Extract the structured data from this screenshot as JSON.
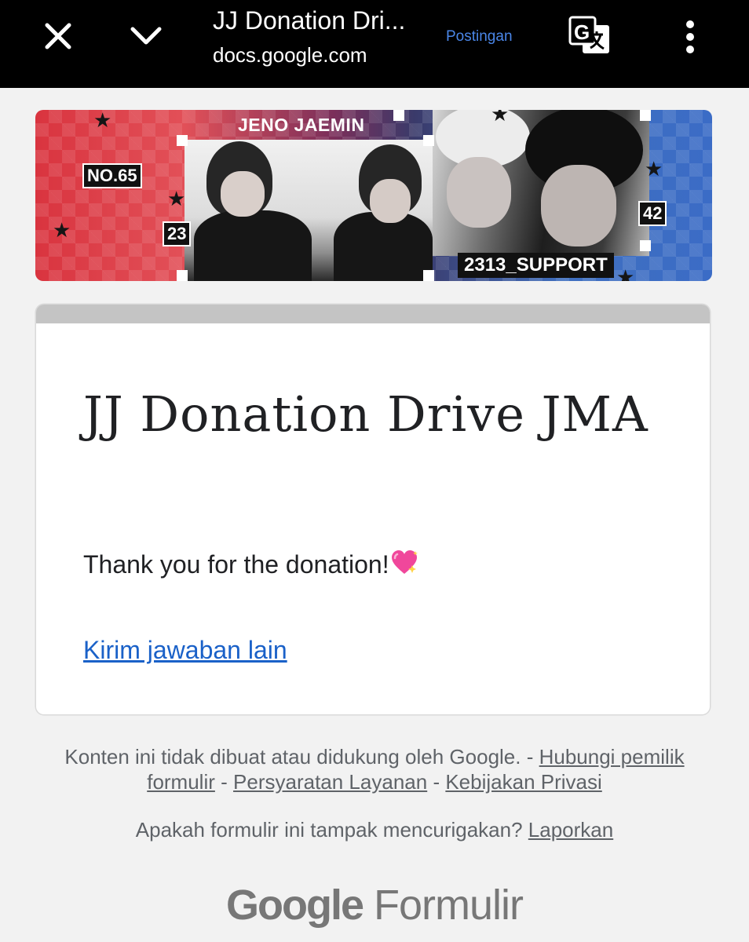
{
  "browser": {
    "title": "JJ Donation Dri...",
    "url": "docs.google.com",
    "posting_label": "Postingan",
    "icons": {
      "close": "close-icon",
      "collapse": "chevron-down-icon",
      "translate": "translate-icon",
      "menu": "more-vert-icon"
    },
    "posting_color": "#4a86e8"
  },
  "banner": {
    "top_label": "JENO JAEMIN",
    "left_label": "NO.65",
    "left_number": "23",
    "right_number": "42",
    "bottom_label": "2313_SUPPORT",
    "colors": {
      "left": "#d9343f",
      "right": "#3b6cc6"
    }
  },
  "form": {
    "title": "JJ Donation Drive JMA",
    "message": "Thank you for the donation!",
    "message_emoji": "sparkling-heart-icon",
    "submit_another_link": "Kirim jawaban lain",
    "link_color": "#1a61c8"
  },
  "footer": {
    "disclaimer": "Konten ini tidak dibuat atau didukung oleh Google. -",
    "contact_owner": "Hubungi pemilik formulir",
    "separator": "-",
    "terms": "Persyaratan Layanan",
    "privacy": "Kebijakan Privasi",
    "report_question": "Apakah formulir ini tampak mencurigakan?",
    "report_link": "Laporkan",
    "brand_google": "Google",
    "brand_product": "Formulir"
  }
}
